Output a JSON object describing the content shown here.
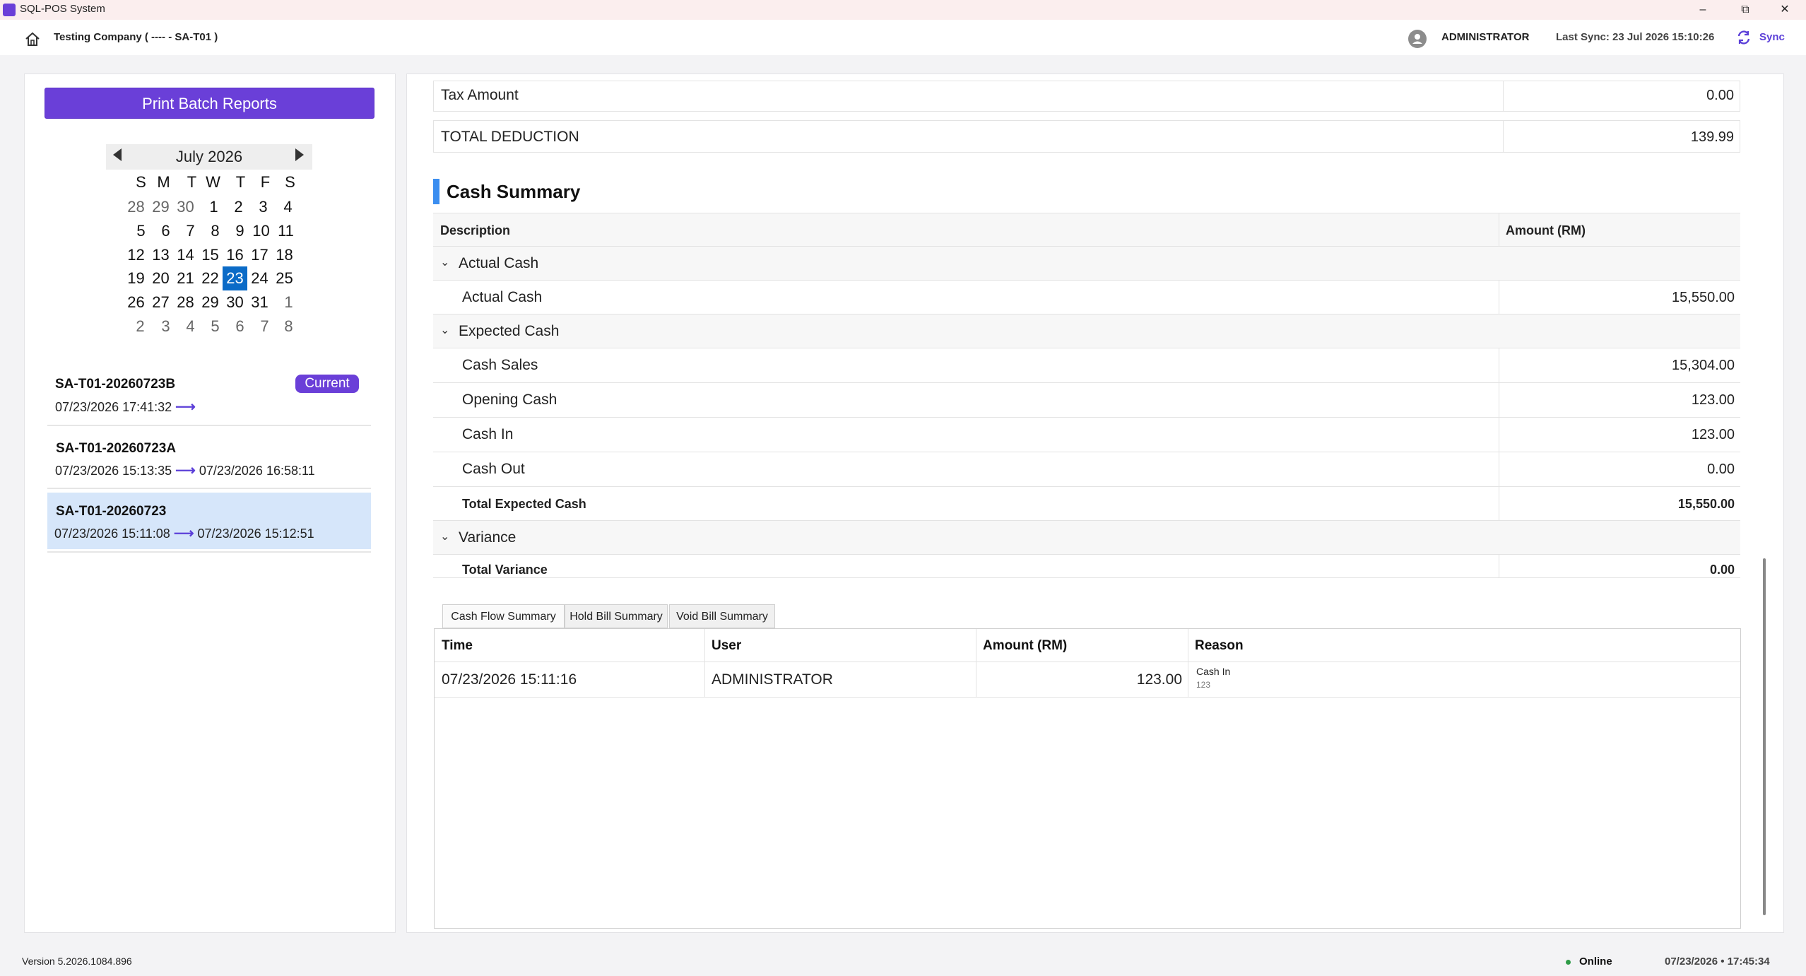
{
  "window": {
    "title": "SQL-POS System",
    "minimize": "–",
    "restore": "⧉",
    "close": "✕"
  },
  "header": {
    "company": "Testing Company ( ---- - SA-T01 )",
    "user": "ADMINISTRATOR",
    "last_sync": "Last Sync: 23 Jul 2026 15:10:26",
    "sync_label": "Sync"
  },
  "left": {
    "print_button": "Print Batch Reports",
    "calendar": {
      "title": "July 2026",
      "weekdays": [
        "S",
        "M",
        "T",
        "W",
        "T",
        "F",
        "S"
      ],
      "weeks": [
        [
          "28",
          "29",
          "30",
          "1",
          "2",
          "3",
          "4"
        ],
        [
          "5",
          "6",
          "7",
          "8",
          "9",
          "10",
          "11"
        ],
        [
          "12",
          "13",
          "14",
          "15",
          "16",
          "17",
          "18"
        ],
        [
          "19",
          "20",
          "21",
          "22",
          "23",
          "24",
          "25"
        ],
        [
          "26",
          "27",
          "28",
          "29",
          "30",
          "31",
          "1"
        ],
        [
          "2",
          "3",
          "4",
          "5",
          "6",
          "7",
          "8"
        ]
      ],
      "selected": "23"
    },
    "batches": [
      {
        "id": "SA-T01-20260723B",
        "start": "07/23/2026 17:41:32",
        "arrow": "⟶",
        "end": "",
        "badge": "Current"
      },
      {
        "id": "SA-T01-20260723A",
        "start": "07/23/2026 15:13:35",
        "arrow": "⟶",
        "end": "07/23/2026 16:58:11"
      },
      {
        "id": "SA-T01-20260723",
        "start": "07/23/2026 15:11:08",
        "arrow": "⟶",
        "end": "07/23/2026 15:12:51"
      }
    ]
  },
  "deductions": {
    "tax_label": "Tax Amount",
    "tax_value": "0.00",
    "total_label": "TOTAL DEDUCTION",
    "total_value": "139.99"
  },
  "cash_summary": {
    "title": "Cash Summary",
    "col_description": "Description",
    "col_amount": "Amount (RM)",
    "groups": {
      "actual": {
        "label": "Actual Cash",
        "rows": [
          {
            "label": "Actual Cash",
            "value": "15,550.00"
          }
        ]
      },
      "expected": {
        "label": "Expected Cash",
        "rows": [
          {
            "label": "Cash Sales",
            "value": "15,304.00"
          },
          {
            "label": "Opening Cash",
            "value": "123.00"
          },
          {
            "label": "Cash In",
            "value": "123.00"
          },
          {
            "label": "Cash Out",
            "value": "0.00"
          }
        ],
        "total_label": "Total Expected Cash",
        "total_value": "15,550.00"
      },
      "variance": {
        "label": "Variance",
        "total_label": "Total Variance",
        "total_value": "0.00"
      }
    }
  },
  "tabs": [
    "Cash Flow Summary",
    "Hold Bill Summary",
    "Void Bill Summary"
  ],
  "cash_flow": {
    "columns": [
      "Time",
      "User",
      "Amount (RM)",
      "Reason"
    ],
    "rows": [
      {
        "time": "07/23/2026 15:11:16",
        "user": "ADMINISTRATOR",
        "amount": "123.00",
        "reason": "Cash In",
        "reason_note": "123"
      }
    ]
  },
  "footer": {
    "version": "Version 5.2026.1084.896",
    "status": "Online",
    "datetime": "07/23/2026  • 17:45:34"
  },
  "colors": {
    "accent": "#6a3fd8",
    "selected_day": "#0b6bc7",
    "section_bar": "#3b8ef0",
    "online": "#2e9b47"
  }
}
